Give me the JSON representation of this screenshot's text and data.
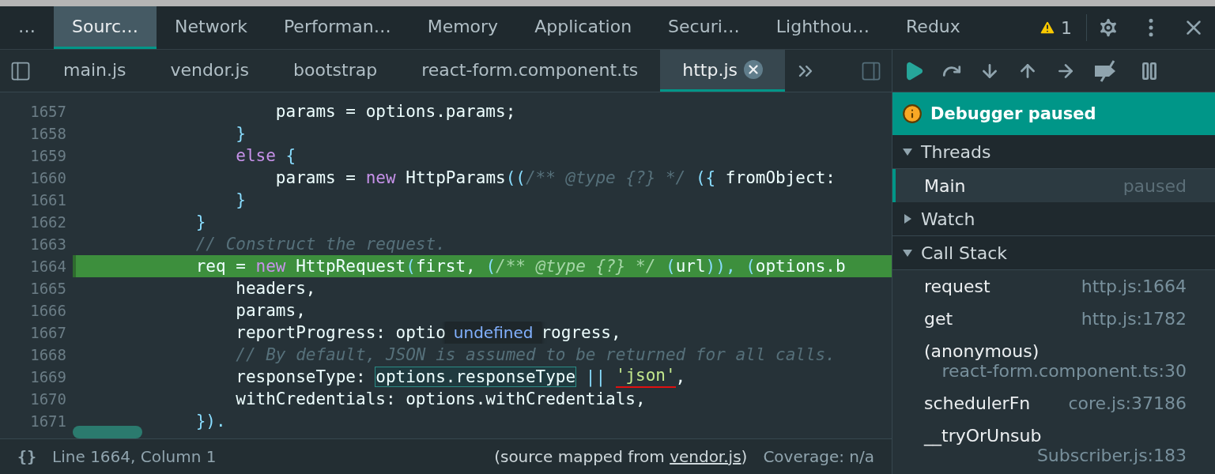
{
  "main_tabs": [
    {
      "label": "…",
      "selected": false
    },
    {
      "label": "Sourc…",
      "selected": true
    },
    {
      "label": "Network",
      "selected": false
    },
    {
      "label": "Performan…",
      "selected": false
    },
    {
      "label": "Memory",
      "selected": false
    },
    {
      "label": "Application",
      "selected": false
    },
    {
      "label": "Securi…",
      "selected": false
    },
    {
      "label": "Lighthou…",
      "selected": false
    },
    {
      "label": "Redux",
      "selected": false
    }
  ],
  "warnings": "1",
  "file_tabs": [
    {
      "label": "main.js",
      "selected": false
    },
    {
      "label": "vendor.js",
      "selected": false
    },
    {
      "label": "bootstrap",
      "selected": false
    },
    {
      "label": "react-form.component.ts",
      "selected": false
    },
    {
      "label": "http.js",
      "selected": true
    }
  ],
  "code_lines": [
    {
      "number": "1657",
      "paused": false,
      "tokens": [
        {
          "kind": "plain",
          "text": "                    params = options.params;"
        }
      ]
    },
    {
      "number": "1658",
      "paused": false,
      "tokens": [
        {
          "kind": "punct",
          "text": "                }"
        }
      ]
    },
    {
      "number": "1659",
      "paused": false,
      "tokens": [
        {
          "kind": "kw",
          "text": "                else"
        },
        {
          "kind": "punct",
          "text": " {"
        }
      ]
    },
    {
      "number": "1660",
      "paused": false,
      "tokens": [
        {
          "kind": "plain",
          "text": "                    params = "
        },
        {
          "kind": "kw",
          "text": "new"
        },
        {
          "kind": "plain",
          "text": " HttpParams"
        },
        {
          "kind": "punct",
          "text": "(("
        },
        {
          "kind": "comment",
          "text": "/** @type {?} */"
        },
        {
          "kind": "punct",
          "text": " ({"
        },
        {
          "kind": "plain",
          "text": " fromObject:"
        }
      ]
    },
    {
      "number": "1661",
      "paused": false,
      "tokens": [
        {
          "kind": "punct",
          "text": "                }"
        }
      ]
    },
    {
      "number": "1662",
      "paused": false,
      "tokens": [
        {
          "kind": "punct",
          "text": "            }"
        }
      ]
    },
    {
      "number": "1663",
      "paused": false,
      "tokens": [
        {
          "kind": "comment",
          "text": "            // Construct the request."
        }
      ]
    },
    {
      "number": "1664",
      "paused": true,
      "tokens": [
        {
          "kind": "plain",
          "text": "            req = "
        },
        {
          "kind": "kw",
          "text": "new"
        },
        {
          "kind": "plain",
          "text": " HttpRequest"
        },
        {
          "kind": "punct",
          "text": "("
        },
        {
          "kind": "plain",
          "text": "first, "
        },
        {
          "kind": "punct",
          "text": "("
        },
        {
          "kind": "comment",
          "text": "/** @type {?} */"
        },
        {
          "kind": "punct",
          "text": " ("
        },
        {
          "kind": "plain",
          "text": "url"
        },
        {
          "kind": "punct",
          "text": ")), ("
        },
        {
          "kind": "plain",
          "text": "options.b"
        }
      ]
    },
    {
      "number": "1665",
      "paused": false,
      "tokens": [
        {
          "kind": "plain",
          "text": "                headers,"
        }
      ]
    },
    {
      "number": "1666",
      "paused": false,
      "tokens": [
        {
          "kind": "plain",
          "text": "                params,"
        }
      ]
    },
    {
      "number": "1667",
      "paused": false,
      "tokens": [
        {
          "kind": "plain",
          "text": "                reportProgress: optio"
        },
        {
          "kind": "tooltip",
          "text": "undefined"
        },
        {
          "kind": "plain",
          "text": "rogress,"
        }
      ]
    },
    {
      "number": "1668",
      "paused": false,
      "tokens": [
        {
          "kind": "comment",
          "text": "                // By default, JSON is assumed to be returned for all calls."
        }
      ]
    },
    {
      "number": "1669",
      "paused": false,
      "tokens": [
        {
          "kind": "plain",
          "text": "                responseType: "
        },
        {
          "kind": "hover",
          "text": "options.responseType"
        },
        {
          "kind": "punct",
          "text": " || "
        },
        {
          "kind": "marked_string",
          "text": "'json'"
        },
        {
          "kind": "plain",
          "text": ","
        }
      ]
    },
    {
      "number": "1670",
      "paused": false,
      "tokens": [
        {
          "kind": "plain",
          "text": "                withCredentials: options.withCredentials,"
        }
      ]
    },
    {
      "number": "1671",
      "paused": false,
      "tokens": [
        {
          "kind": "punct",
          "text": "            })."
        }
      ]
    }
  ],
  "status_bar": {
    "format_button": "{}",
    "position": "Line 1664, Column 1",
    "source_prefix": "(source mapped from ",
    "source_link": "vendor.js",
    "source_suffix": ")",
    "coverage": "Coverage: n/a"
  },
  "debugger": {
    "banner": "Debugger paused",
    "sections": [
      {
        "title": "Threads",
        "expanded": true,
        "items": [
          {
            "name": "Main",
            "status": "paused",
            "selected": true
          }
        ]
      },
      {
        "title": "Watch",
        "expanded": false
      },
      {
        "title": "Call Stack",
        "expanded": true,
        "frames": [
          {
            "name": "request",
            "location": "http.js:1664"
          },
          {
            "name": "get",
            "location": "http.js:1782"
          },
          {
            "name": "(anonymous)",
            "location": "react-form.component.ts:30"
          },
          {
            "name": "schedulerFn",
            "location": "core.js:37186"
          },
          {
            "name": "__tryOrUnsub",
            "location": "Subscriber.js:183"
          }
        ]
      }
    ]
  }
}
